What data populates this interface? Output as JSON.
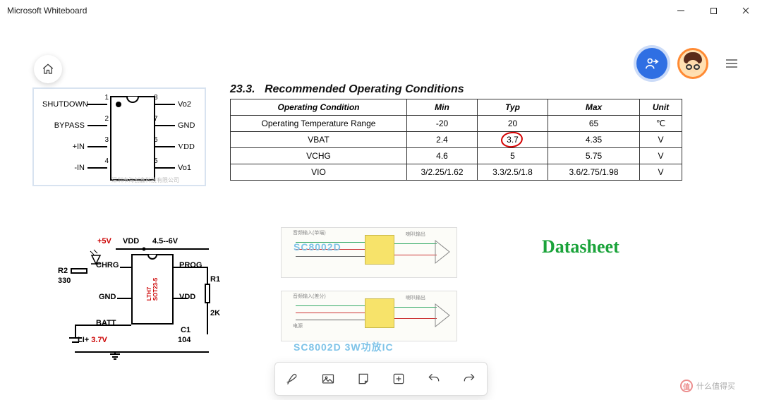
{
  "window": {
    "title": "Microsoft Whiteboard"
  },
  "chip": {
    "pins_left": [
      {
        "num": "1",
        "label": "SHUTDOWN"
      },
      {
        "num": "2",
        "label": "BYPASS"
      },
      {
        "num": "3",
        "label": "+IN"
      },
      {
        "num": "4",
        "label": "-IN"
      }
    ],
    "pins_right": [
      {
        "num": "8",
        "label": "Vo2"
      },
      {
        "num": "7",
        "label": "GND"
      },
      {
        "num": "6",
        "label": "VDD"
      },
      {
        "num": "5",
        "label": "Vo1"
      }
    ],
    "watermark": "深圳市海创鑫科技有限公司"
  },
  "table": {
    "section_no": "23.3.",
    "section_title": "Recommended Operating Conditions",
    "headers": [
      "Operating Condition",
      "Min",
      "Typ",
      "Max",
      "Unit"
    ],
    "rows": [
      {
        "cond": "Operating Temperature Range",
        "min": "-20",
        "typ": "20",
        "max": "65",
        "unit": "℃",
        "circle_typ": false
      },
      {
        "cond": "VBAT",
        "min": "2.4",
        "typ": "3.7",
        "max": "4.35",
        "unit": "V",
        "circle_typ": true
      },
      {
        "cond": "VCHG",
        "min": "4.6",
        "typ": "5",
        "max": "5.75",
        "unit": "V",
        "circle_typ": false
      },
      {
        "cond": "VIO",
        "min": "3/2.25/1.62",
        "typ": "3.3/2.5/1.8",
        "max": "3.6/2.75/1.98",
        "unit": "V",
        "circle_typ": false
      }
    ]
  },
  "circuit2": {
    "supply": "+5V",
    "vdd": "VDD",
    "vrange": "4.5--6V",
    "labels": {
      "chrg": "CHRG",
      "prog": "PROG",
      "gnd": "GND",
      "vdd2": "VDD",
      "batt": "BATT",
      "r2": "R2",
      "r2v": "330",
      "r1": "R1",
      "r1v": "2K",
      "c1": "C1",
      "c1v": "104",
      "li": "LI+",
      "liv": "3.7V",
      "ic": "LTH7",
      "pkg": "SOT23-5"
    }
  },
  "schematics": {
    "caption1": "SC8002D",
    "caption2": "SC8002D 3W功放IC"
  },
  "note": "Datasheet",
  "watermark_corner": {
    "symbol": "值",
    "text": "什么值得买"
  },
  "toolbar_icons": [
    "pen-icon",
    "image-icon",
    "note-icon",
    "add-icon",
    "undo-icon",
    "redo-icon"
  ]
}
